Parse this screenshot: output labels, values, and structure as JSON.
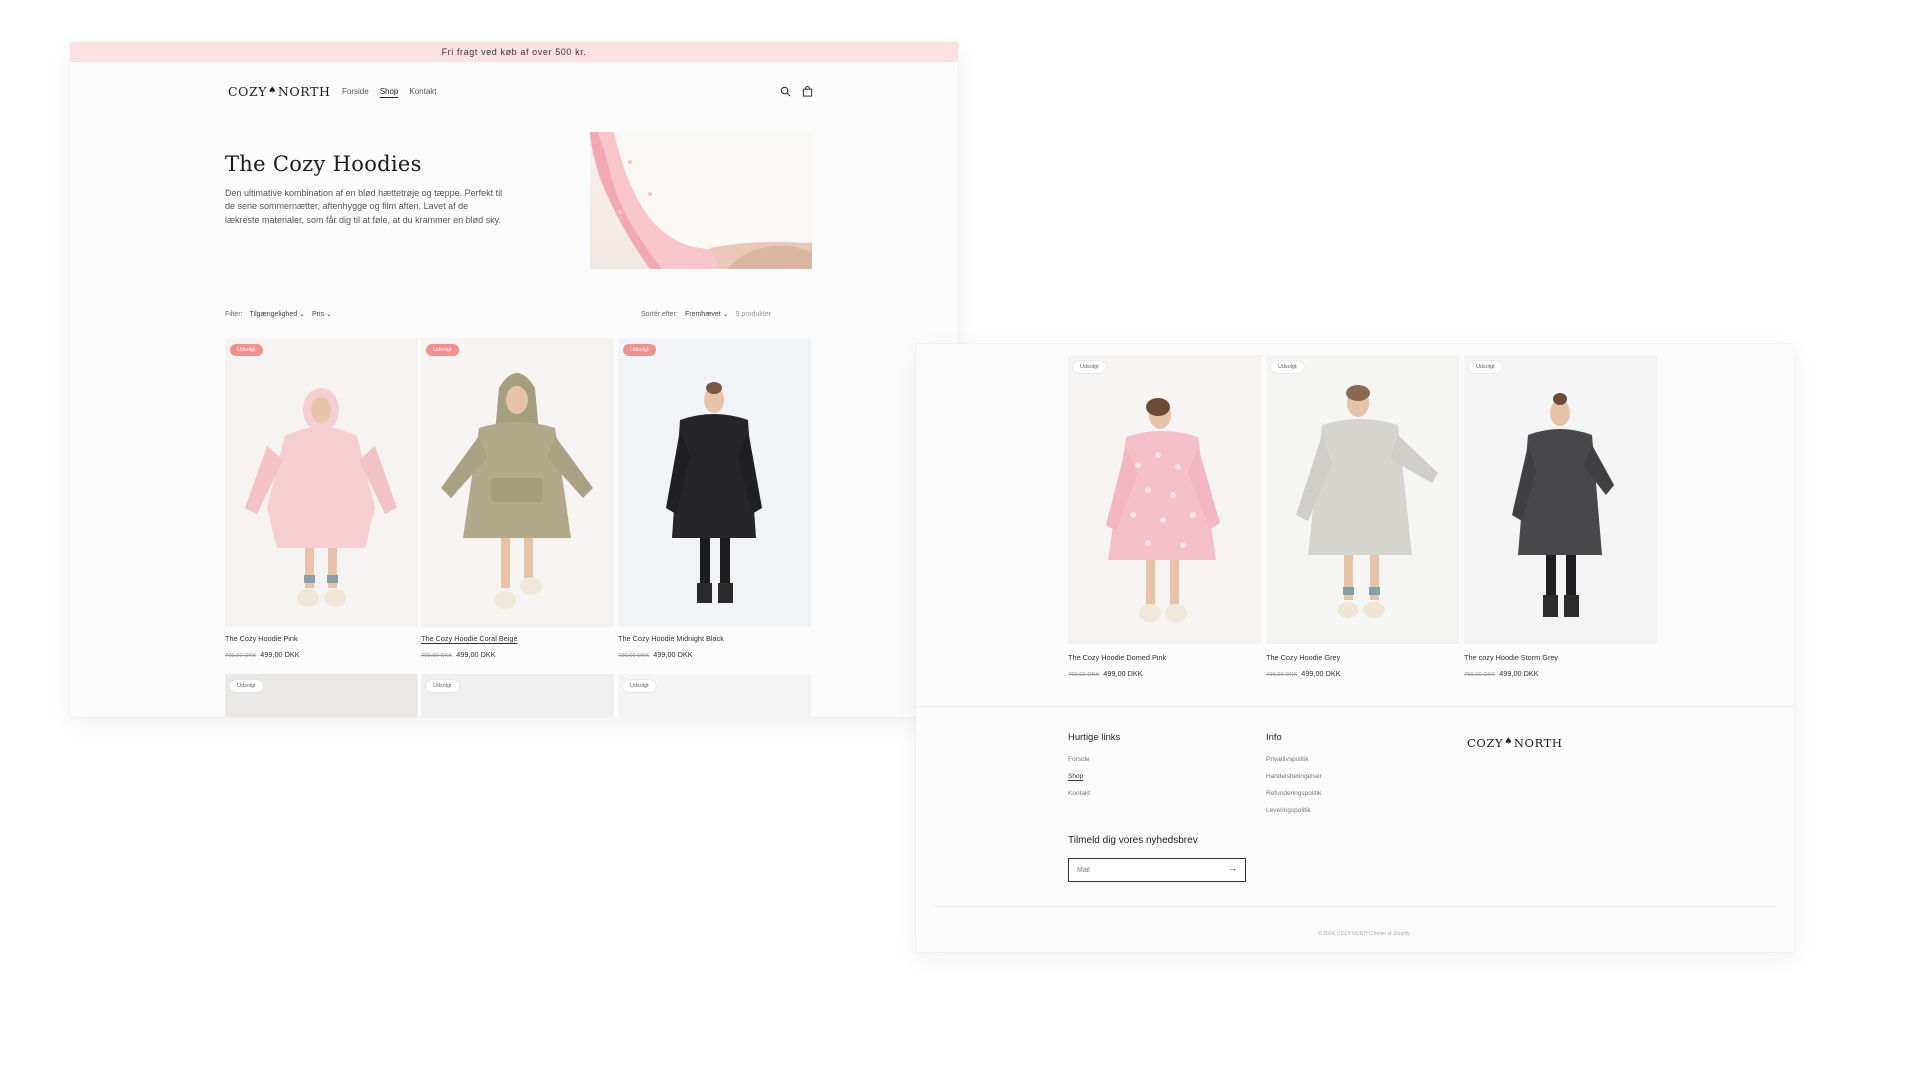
{
  "announcement": "Fri fragt ved køb af over 500 kr.",
  "brand": {
    "left": "COZY",
    "mark": "♠",
    "right": "NORTH"
  },
  "nav": {
    "items": [
      "Forside",
      "Shop",
      "Kontakt"
    ],
    "active_index": 1
  },
  "icons": {
    "search": "search-icon",
    "cart": "cart-icon"
  },
  "collection": {
    "title": "The Cozy Hoodies",
    "description": "Den ultimative kombination af en blød hættetrøje og tæppe. Perfekt til de sene sommernætter, aftenhygge og film aften. Lavet af de lækreste materialer, som får dig til at føle, at du krammer en blød sky."
  },
  "filters": {
    "label": "Filter:",
    "availability": "Tilgængelighed",
    "price": "Pris",
    "sort_label": "Sortér efter:",
    "sort_value": "Fremhævet",
    "count": "9 produkter"
  },
  "badge": "Udsolgt",
  "products_top": [
    {
      "title": "The Cozy Hoodie Pink",
      "old_price": "799,00 DKK",
      "price": "499,00 DKK"
    },
    {
      "title": "The Cozy Hoodie Coral Beige",
      "old_price": "799,00 DKK",
      "price": "499,00 DKK"
    },
    {
      "title": "The Cozy Hoodie Midnight Black",
      "old_price": "799,00 DKK",
      "price": "499,00 DKK"
    }
  ],
  "products_bottom": [
    {
      "title": "The Cozy Hoodie Domed Pink",
      "old_price": "799,00 DKK",
      "price": "499,00 DKK"
    },
    {
      "title": "The Cozy Hoodie Grey",
      "old_price": "799,00 DKK",
      "price": "499,00 DKK"
    },
    {
      "title": "The cozy Hoodie Storm Grey",
      "old_price": "799,00 DKK",
      "price": "499,00 DKK"
    }
  ],
  "footer": {
    "quick_links_title": "Hurtige links",
    "quick_links": [
      "Forside",
      "Shop",
      "Kontakt"
    ],
    "info_title": "Info",
    "info_links": [
      "Privatlivspolitik",
      "Handelsbetingelser",
      "Refunderingspolitik",
      "Leveringspolitik"
    ],
    "newsletter_title": "Tilmeld dig vores nyhedsbrev",
    "mail_placeholder": "Mail",
    "copyright": "© 2024, COZY NORTH Drevet af Shopify"
  },
  "colors": {
    "announcement_bg": "#fbe1e1",
    "sale_badge": "#f0918e",
    "hoodie_pink": "#f6cdd0",
    "hoodie_beige": "#b2a98d",
    "hoodie_black": "#262628",
    "hoodie_domed_pink": "#f5bfc9",
    "hoodie_grey": "#d5d4cf",
    "hoodie_storm_grey": "#48484b"
  }
}
